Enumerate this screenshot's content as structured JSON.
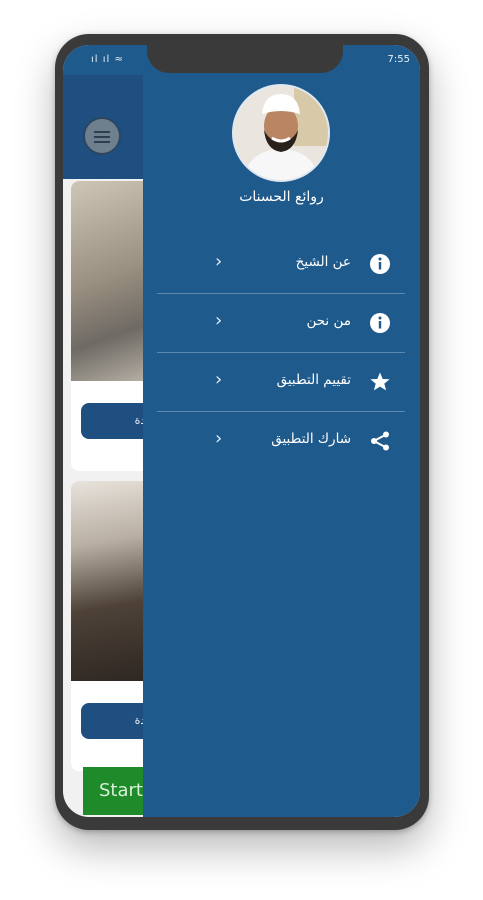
{
  "status_bar": {
    "signal_text": "ıl ıl ≈",
    "battery_and_time": "7:55"
  },
  "background_app": {
    "watch_label": "مشاهدة",
    "start_label": "Start"
  },
  "drawer": {
    "title": "روائع الحسنات",
    "items": [
      {
        "label": "عن الشيخ",
        "icon": "info-icon"
      },
      {
        "label": "من نحن",
        "icon": "info-icon"
      },
      {
        "label": "تقييم التطبيق",
        "icon": "star-icon"
      },
      {
        "label": "شارك التطبيق",
        "icon": "share-icon"
      }
    ]
  },
  "colors": {
    "drawer_bg": "#1f5a8c",
    "header_bg": "#1e4f80",
    "start_button": "#1f8a2a"
  }
}
